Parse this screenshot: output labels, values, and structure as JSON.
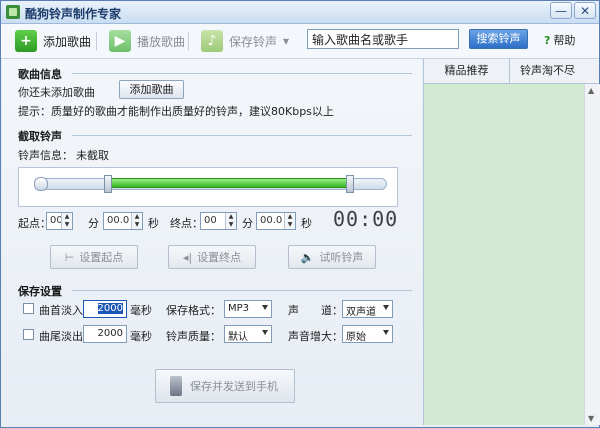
{
  "window": {
    "title": "酷狗铃声制作专家",
    "minimize": "—",
    "close": "✕"
  },
  "toolbar": {
    "add_song": "添加歌曲",
    "play_song": "播放歌曲",
    "save_ringtone": "保存铃声",
    "save_dropdown": "▾",
    "search_value": "输入歌曲名或歌手",
    "search_button": "搜索铃声",
    "help_icon": "?",
    "help": "帮助"
  },
  "song_info": {
    "title": "歌曲信息",
    "status": "你还未添加歌曲",
    "add_button": "添加歌曲",
    "tip": "提示：质量好的歌曲才能制作出质量好的铃声，建议80Kbps以上"
  },
  "clip": {
    "title": "截取铃声",
    "info_label": "铃声信息：",
    "info_value": "未截取",
    "start_label": "起点：",
    "start_min": "00",
    "min_unit": "分",
    "start_sec": "00.0",
    "sec_unit": "秒",
    "end_label": "终点：",
    "end_min": "00",
    "end_sec": "00.0",
    "timer": "00:00",
    "set_start": "设置起点",
    "set_end": "设置终点",
    "preview": "试听铃声"
  },
  "save": {
    "title": "保存设置",
    "fade_in": "曲首淡入",
    "fade_in_value": "2000",
    "fade_out": "曲尾淡出",
    "fade_out_value": "2000",
    "ms_unit": "毫秒",
    "format_label": "保存格式：",
    "format_value": "MP3",
    "quality_label": "铃声质量：",
    "quality_value": "默认",
    "channel_label": "声　　道：",
    "channel_value": "双声道",
    "gain_label": "声音增大：",
    "gain_value": "原始",
    "send_button": "保存并发送到手机"
  },
  "side_tabs": [
    "精品推荐",
    "铃声淘不尽"
  ],
  "colors": {
    "accent": "#2d6fc8",
    "green_fill": "#34b520",
    "list_bg": "#d3ead2"
  }
}
